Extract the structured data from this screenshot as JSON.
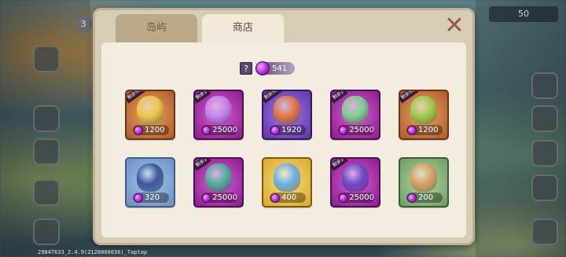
{
  "top_count": "50",
  "level": "3",
  "version_text": "29847633_2.4.9(2120000036)_Taptap",
  "tabs": [
    {
      "label": "岛屿",
      "active": false
    },
    {
      "label": "商店",
      "active": true
    }
  ],
  "close_label": "✕",
  "currency": {
    "help_label": "?",
    "gems": "541"
  },
  "items": [
    {
      "name": "leaf-egg",
      "price": "1200",
      "ribbon": "剩余50",
      "color": "orange",
      "art": "#e8c84a"
    },
    {
      "name": "castle-island",
      "price": "25000",
      "ribbon": "剩余1",
      "color": "magenta",
      "art": "#c084e8"
    },
    {
      "name": "spotted-egg",
      "price": "1920",
      "ribbon": "剩余50",
      "color": "purple",
      "art": "#e27a3a"
    },
    {
      "name": "flower-island",
      "price": "25000",
      "ribbon": "剩余1",
      "color": "magenta",
      "art": "#7ad08a"
    },
    {
      "name": "green-egg",
      "price": "1200",
      "ribbon": "剩余50",
      "color": "orange",
      "art": "#9acc4a"
    },
    {
      "name": "dragon-egg",
      "price": "320",
      "ribbon": "",
      "color": "blue",
      "art": "#3a5a9a"
    },
    {
      "name": "crystal-island",
      "price": "25000",
      "ribbon": "剩余1",
      "color": "magenta",
      "art": "#4ab09a"
    },
    {
      "name": "mystery-egg",
      "price": "400",
      "ribbon": "",
      "color": "yellow",
      "art": "#6ab0e8"
    },
    {
      "name": "tower-island",
      "price": "25000",
      "ribbon": "剩余1",
      "color": "magenta",
      "art": "#6a4ac8"
    },
    {
      "name": "mystery-egg-brown",
      "price": "200",
      "ribbon": "",
      "color": "green",
      "art": "#d9a060"
    }
  ]
}
